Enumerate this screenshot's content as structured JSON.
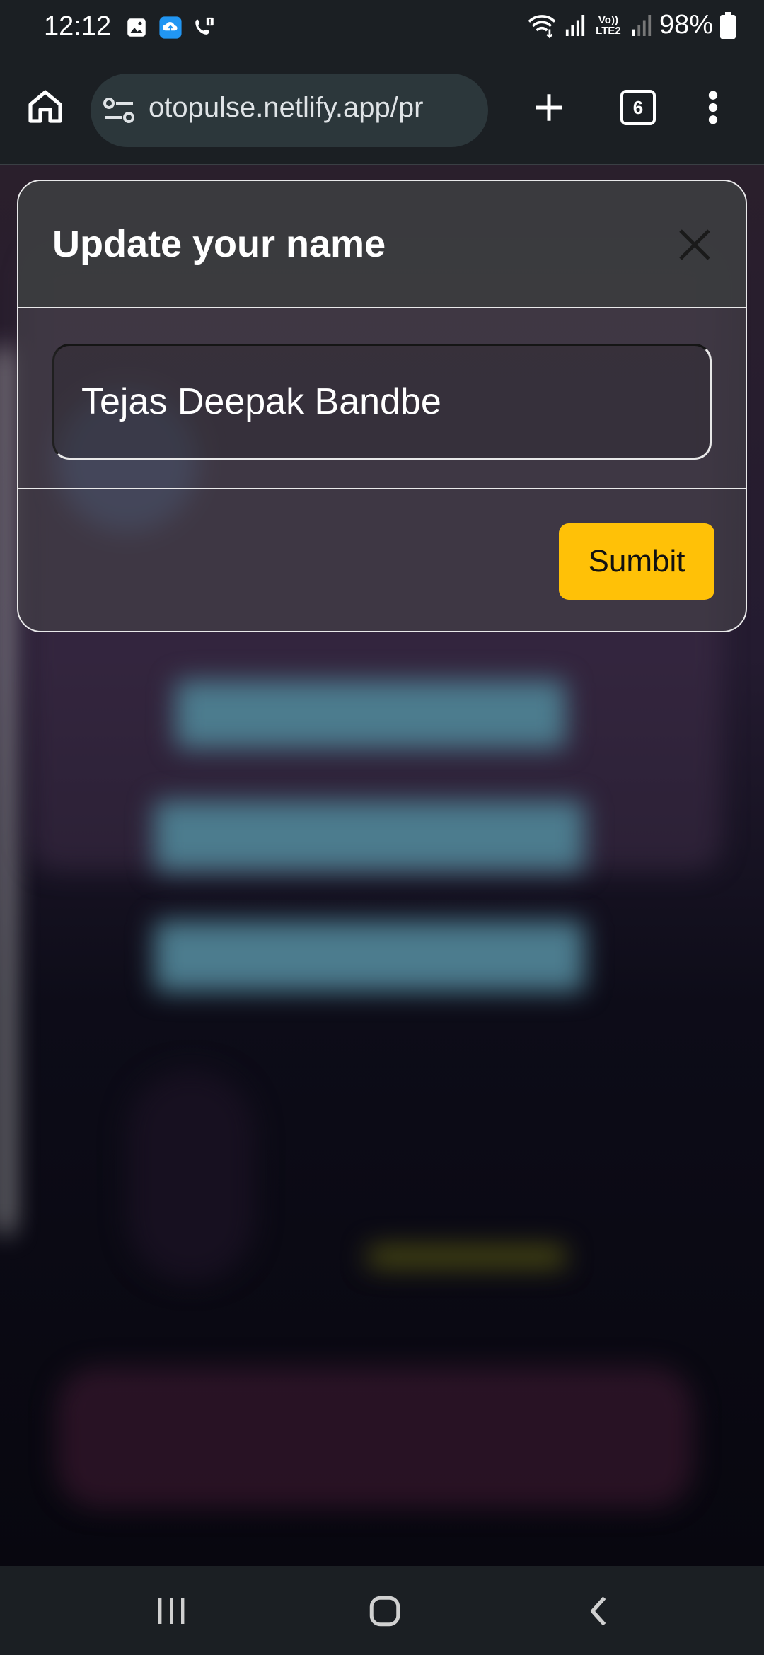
{
  "status_bar": {
    "time": "12:12",
    "network_label": "Vo)) LTE2",
    "battery": "98%"
  },
  "browser": {
    "url": "otopulse.netlify.app/pr",
    "tab_count": "6"
  },
  "modal": {
    "title": "Update your name",
    "name_value": "Tejas Deepak Bandbe",
    "submit_label": "Sumbit"
  },
  "colors": {
    "submit_bg": "#ffc107",
    "chrome_bg": "#1b1f23"
  },
  "icons": [
    "home-icon",
    "tune-icon",
    "plus-icon",
    "tabs-icon",
    "more-vert-icon",
    "close-icon",
    "recents-icon",
    "home-nav-icon",
    "back-icon"
  ]
}
